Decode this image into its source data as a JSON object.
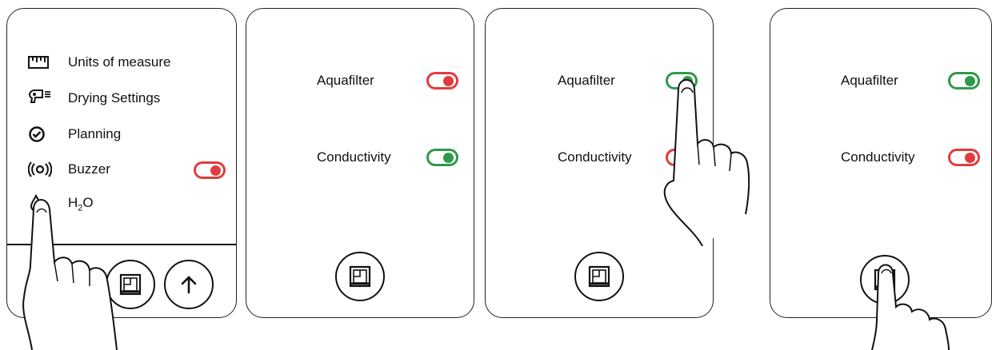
{
  "panel1": {
    "menu": [
      {
        "label": "Units of measure",
        "icon": "ruler-icon"
      },
      {
        "label": "Drying Settings",
        "icon": "hair-dryer-icon"
      },
      {
        "label": "Planning",
        "icon": "check-circle-icon"
      },
      {
        "label": "Buzzer",
        "icon": "buzzer-icon"
      },
      {
        "label": "H2O",
        "icon": "water-drop-icon"
      }
    ],
    "buzzer_toggle": "off",
    "buttons": [
      "frame-icon",
      "arrow-up-icon"
    ]
  },
  "panel2": {
    "settings": [
      {
        "label": "Aquafilter",
        "state": "off"
      },
      {
        "label": "Conductivity",
        "state": "on"
      }
    ]
  },
  "panel3": {
    "settings": [
      {
        "label": "Aquafilter",
        "state": "on"
      },
      {
        "label": "Conductivity",
        "state": "off"
      }
    ]
  },
  "panel4": {
    "settings": [
      {
        "label": "Aquafilter",
        "state": "on"
      },
      {
        "label": "Conductivity",
        "state": "off"
      }
    ]
  },
  "colors": {
    "toggle_on": "#2f9a4a",
    "toggle_off": "#e23b3f"
  }
}
